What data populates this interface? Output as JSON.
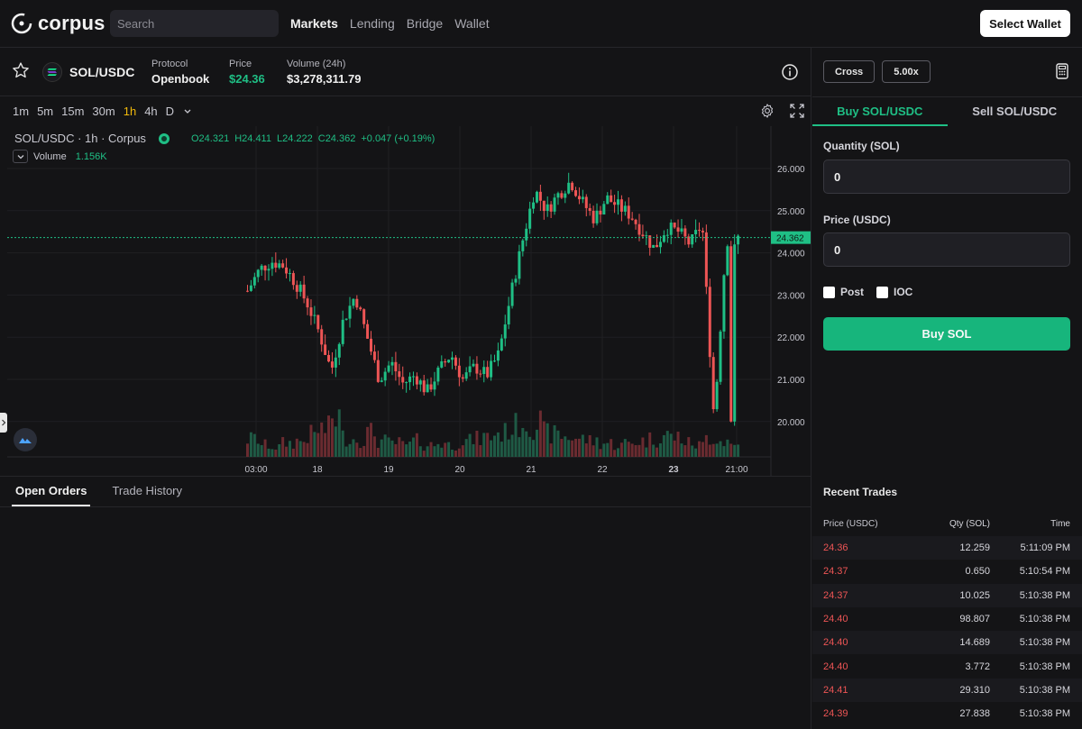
{
  "app": {
    "brand": "corpus"
  },
  "nav": {
    "search_placeholder": "Search",
    "links": [
      "Markets",
      "Lending",
      "Bridge",
      "Wallet"
    ],
    "active": "Markets",
    "select_wallet": "Select Wallet"
  },
  "market": {
    "pair": "SOL/USDC",
    "protocol_label": "Protocol",
    "protocol_value": "Openbook",
    "price_label": "Price",
    "price_value": "$24.36",
    "volume_label": "Volume (24h)",
    "volume_value": "$3,278,311.79"
  },
  "chart_toolbar": {
    "timeframes": [
      "1m",
      "5m",
      "15m",
      "30m",
      "1h",
      "4h",
      "D"
    ],
    "active": "1h"
  },
  "chart": {
    "title": "SOL/USDC · 1h · Corpus",
    "open": "O24.321",
    "high": "H24.411",
    "low": "L24.222",
    "close": "C24.362",
    "change": "+0.047 (+0.19%)",
    "volume_label": "Volume",
    "volume_value": "1.156K",
    "last_price_label": "24.362"
  },
  "chart_data": {
    "type": "candlestick",
    "y_ticks": [
      "26.000",
      "25.000",
      "24.000",
      "23.000",
      "22.000",
      "21.000",
      "20.000"
    ],
    "ylim": [
      19.2,
      26.9
    ],
    "x_ticks": [
      "03:00",
      "18",
      "19",
      "20",
      "21",
      "22",
      "23",
      "21:00"
    ],
    "last_price": 24.362,
    "series_close": [
      23.1,
      23.6,
      23.8,
      23.7,
      23.3,
      22.8,
      22.1,
      21.2,
      22.4,
      23.0,
      22.0,
      21.0,
      21.4,
      20.9,
      21.1,
      20.7,
      21.2,
      21.6,
      21.0,
      21.3,
      21.1,
      21.6,
      23.0,
      24.3,
      25.5,
      25.0,
      25.4,
      25.7,
      25.2,
      24.8,
      25.3,
      25.1,
      24.9,
      24.5,
      24.1,
      24.6,
      24.5,
      24.2,
      24.7,
      20.0,
      24.3,
      24.36
    ],
    "volumes": [
      0.45,
      0.3,
      0.25,
      0.35,
      0.4,
      0.55,
      0.7,
      1.0,
      0.5,
      0.45,
      0.6,
      0.4,
      0.35,
      0.3,
      0.4,
      0.3,
      0.35,
      0.3,
      0.4,
      0.45,
      0.5,
      0.6,
      0.75,
      0.9,
      0.85,
      0.6,
      0.55,
      0.5,
      0.45,
      0.4,
      0.35,
      0.3,
      0.35,
      0.4,
      0.45,
      0.55,
      0.5,
      0.35,
      0.3,
      0.5,
      0.4,
      0.3
    ]
  },
  "order": {
    "mode": "Cross",
    "leverage": "5.00x",
    "buy_tab": "Buy SOL/USDC",
    "sell_tab": "Sell SOL/USDC",
    "quantity_label": "Quantity (SOL)",
    "quantity_value": "0",
    "price_label": "Price (USDC)",
    "price_value": "0",
    "post_label": "Post",
    "ioc_label": "IOC",
    "buy_button": "Buy SOL"
  },
  "bottom": {
    "tabs": [
      "Open Orders",
      "Trade History"
    ],
    "active": "Open Orders"
  },
  "recent_trades": {
    "title": "Recent Trades",
    "headers": [
      "Price (USDC)",
      "Qty (SOL)",
      "Time"
    ],
    "rows": [
      [
        "24.36",
        "12.259",
        "5:11:09 PM"
      ],
      [
        "24.37",
        "0.650",
        "5:10:54 PM"
      ],
      [
        "24.37",
        "10.025",
        "5:10:38 PM"
      ],
      [
        "24.40",
        "98.807",
        "5:10:38 PM"
      ],
      [
        "24.40",
        "14.689",
        "5:10:38 PM"
      ],
      [
        "24.40",
        "3.772",
        "5:10:38 PM"
      ],
      [
        "24.41",
        "29.310",
        "5:10:38 PM"
      ],
      [
        "24.39",
        "27.838",
        "5:10:38 PM"
      ]
    ]
  },
  "colors": {
    "green": "#1fbf85",
    "red": "#ee5555",
    "accent": "#f0b90b"
  }
}
